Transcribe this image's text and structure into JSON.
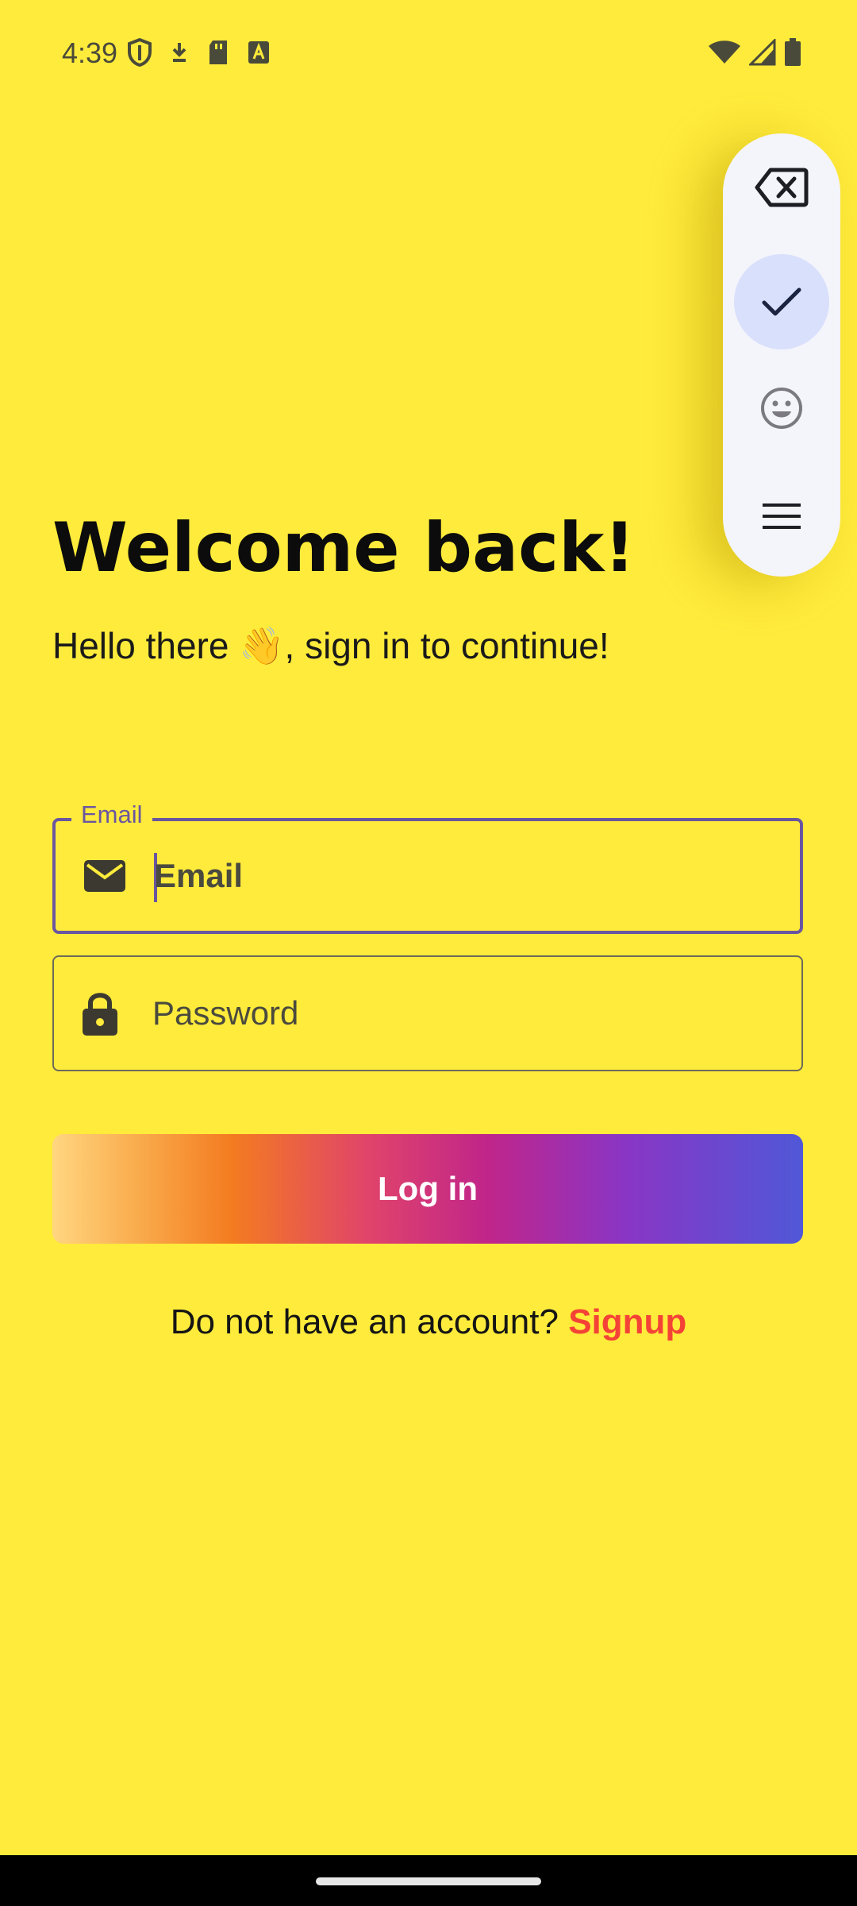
{
  "status_bar": {
    "time": "4:39",
    "left_icons": [
      "shield-icon",
      "download-icon",
      "sd-card-icon",
      "font-a-icon"
    ],
    "right_icons": [
      "wifi-icon",
      "signal-icon",
      "battery-icon"
    ]
  },
  "floating_toolbar": {
    "buttons": [
      "backspace-icon",
      "check-icon",
      "emoji-icon",
      "menu-icon"
    ],
    "active": "check-icon"
  },
  "header": {
    "title": "Welcome back!",
    "subtitle": "Hello there 👋, sign in to continue!"
  },
  "form": {
    "email": {
      "label": "Email",
      "value": "Email",
      "icon": "mail-icon",
      "focused": true
    },
    "password": {
      "placeholder": "Password",
      "icon": "lock-icon"
    }
  },
  "login_button": {
    "label": "Log in"
  },
  "signup": {
    "prompt": "Do not have an account?",
    "link": "Signup"
  },
  "colors": {
    "background": "#ffeb3b",
    "accent": "#6a56a0",
    "link": "#f44336"
  }
}
